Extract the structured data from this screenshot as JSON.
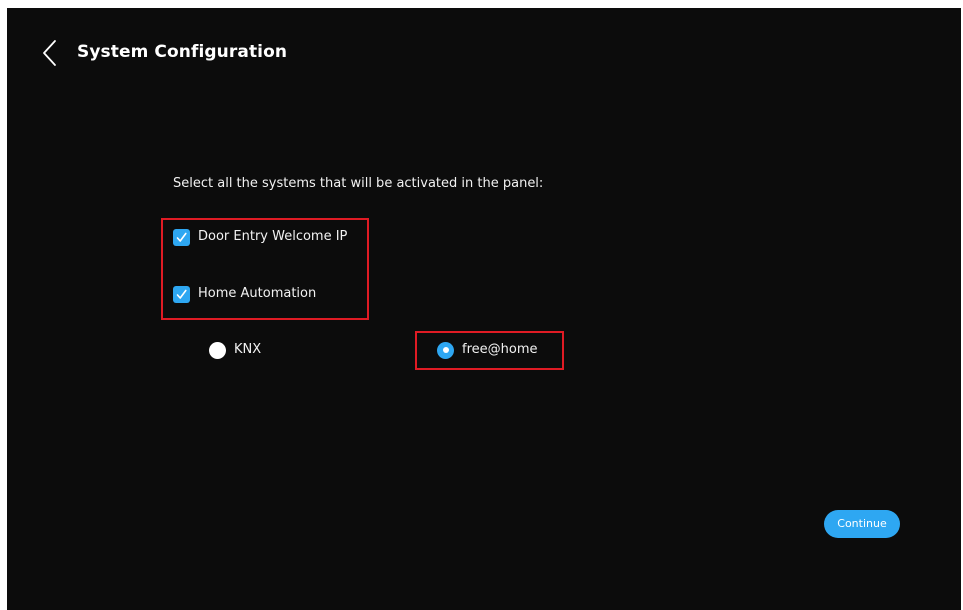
{
  "header": {
    "title": "System Configuration",
    "back_icon": "chevron-left-icon"
  },
  "main": {
    "instruction": "Select all the systems that will be activated in the panel:",
    "systems": [
      {
        "label": "Door Entry Welcome IP",
        "checked": true
      },
      {
        "label": "Home Automation",
        "checked": true
      }
    ],
    "home_automation_options": [
      {
        "label": "KNX",
        "selected": false
      },
      {
        "label": "free@home",
        "selected": true
      }
    ]
  },
  "footer": {
    "continue_label": "Continue"
  },
  "colors": {
    "background": "#0c0c0c",
    "accent": "#2ea7f2",
    "highlight": "#e01b24",
    "text": "#ffffff"
  }
}
